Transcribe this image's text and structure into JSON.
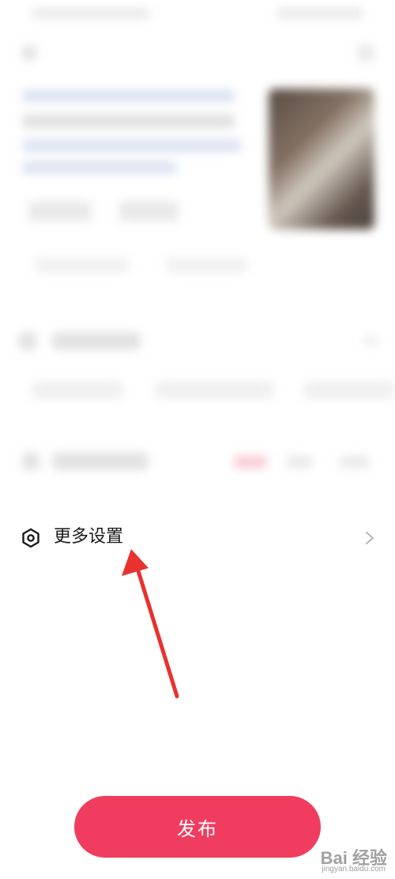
{
  "settings": {
    "more_settings_label": "更多设置",
    "icon": "hexagon-settings-icon",
    "chevron_icon": "chevron-right-icon"
  },
  "publish": {
    "label": "发布",
    "color": "#f03d5f"
  },
  "annotation": {
    "arrow_color": "#e8322e"
  },
  "watermark": {
    "text": "Bai 经验",
    "sub": "jingyan.baidu.com"
  }
}
